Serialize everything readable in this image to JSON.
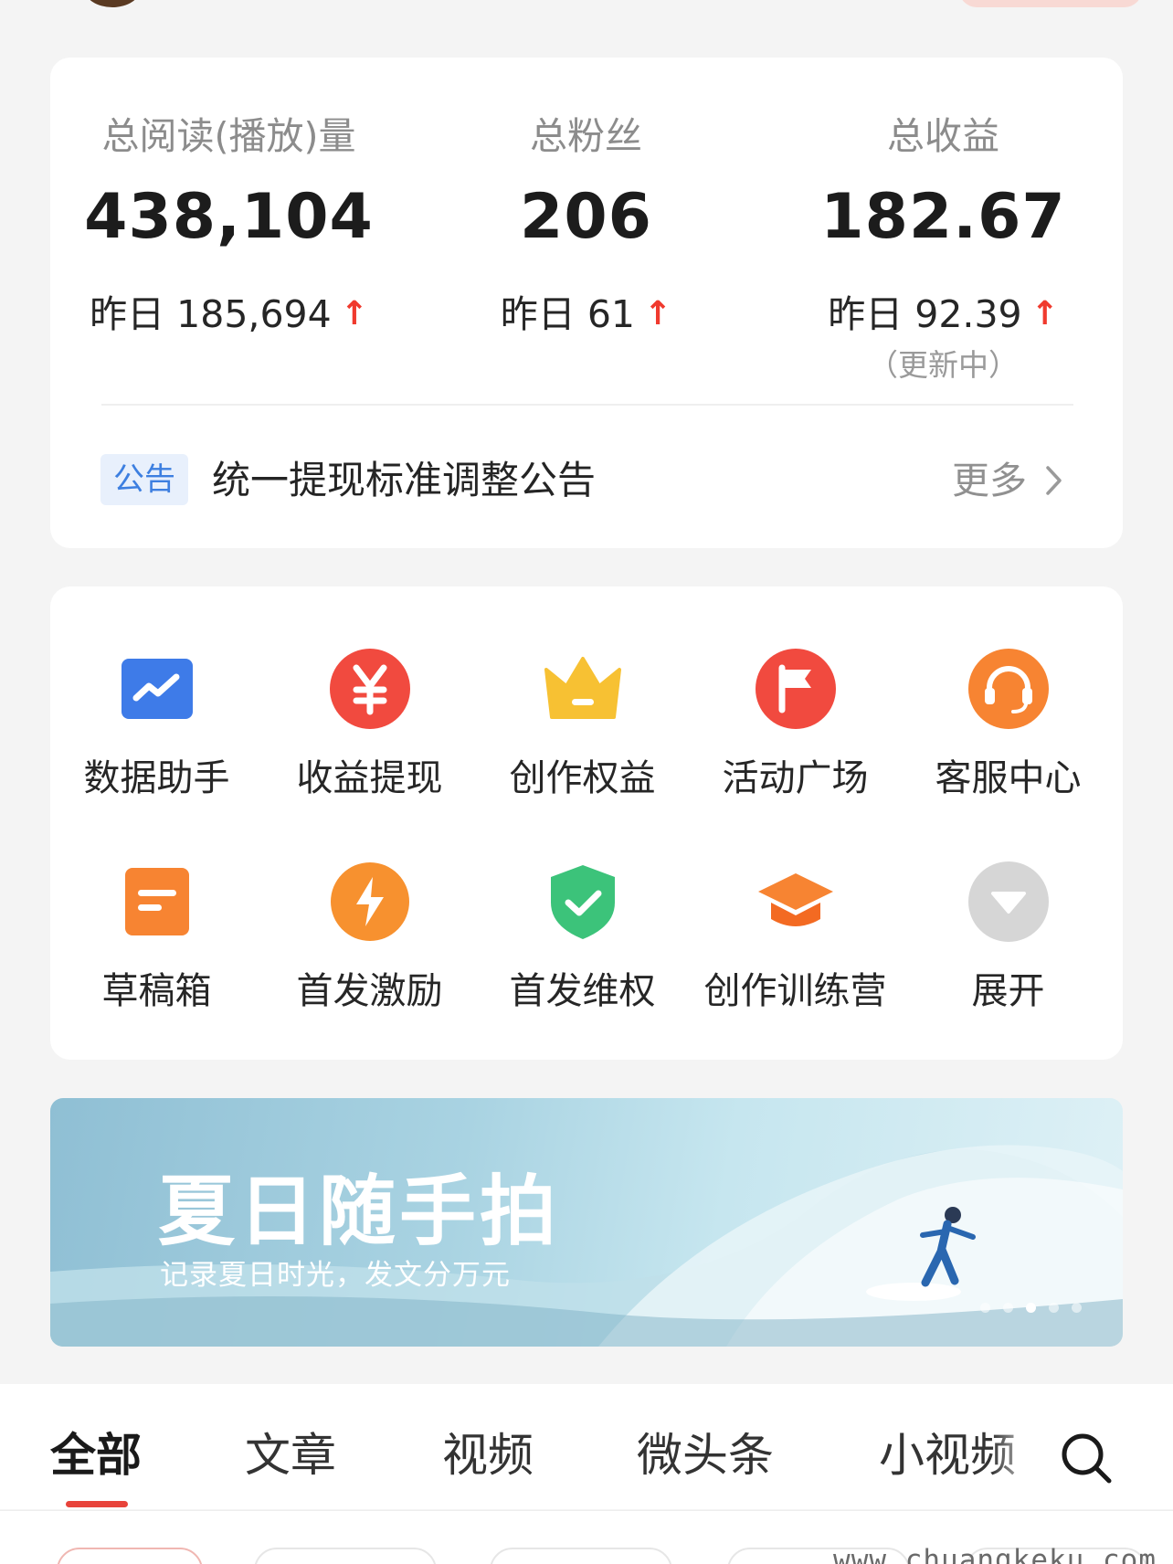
{
  "stats": {
    "reads": {
      "label": "总阅读(播放)量",
      "value": "438,104",
      "yesterday": "昨日 185,694",
      "trend": "↑"
    },
    "fans": {
      "label": "总粉丝",
      "value": "206",
      "yesterday": "昨日 61",
      "trend": "↑"
    },
    "income": {
      "label": "总收益",
      "value": "182.67",
      "yesterday": "昨日 92.39",
      "trend": "↑",
      "note": "（更新中）"
    }
  },
  "notice": {
    "badge": "公告",
    "text": "统一提现标准调整公告",
    "more": "更多"
  },
  "tools": [
    {
      "label": "数据助手",
      "icon": "chart-trend-icon"
    },
    {
      "label": "收益提现",
      "icon": "yuan-coin-icon"
    },
    {
      "label": "创作权益",
      "icon": "crown-icon"
    },
    {
      "label": "活动广场",
      "icon": "flag-icon"
    },
    {
      "label": "客服中心",
      "icon": "headset-icon"
    },
    {
      "label": "草稿箱",
      "icon": "draft-box-icon"
    },
    {
      "label": "首发激励",
      "icon": "lightning-icon"
    },
    {
      "label": "首发维权",
      "icon": "shield-check-icon"
    },
    {
      "label": "创作训练营",
      "icon": "graduation-cap-icon"
    },
    {
      "label": "展开",
      "icon": "expand-down-icon"
    }
  ],
  "banner": {
    "title": "夏日随手拍",
    "subtitle": "记录夏日时光，发文分万元",
    "slide_count": 5,
    "active_slide": 3
  },
  "tabs": [
    {
      "label": "全部",
      "active": true
    },
    {
      "label": "文章",
      "active": false
    },
    {
      "label": "视频",
      "active": false
    },
    {
      "label": "微头条",
      "active": false
    },
    {
      "label": "小视频",
      "active": false
    }
  ],
  "watermark": "www.chuangkeku.com",
  "colors": {
    "accent_red": "#f03a2e",
    "tab_underline": "#e8433a",
    "notice_blue": "#3d7fe0",
    "card_bg": "#ffffff",
    "page_bg": "#f4f4f4"
  }
}
